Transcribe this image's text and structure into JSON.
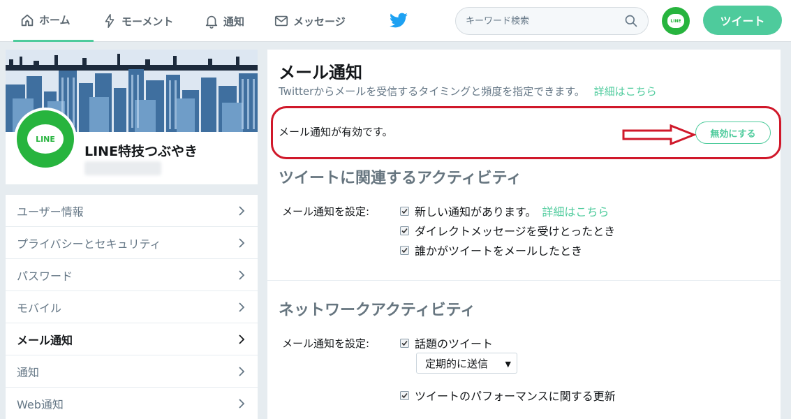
{
  "nav": {
    "home": "ホーム",
    "moments": "モーメント",
    "notifications": "通知",
    "messages": "メッセージ"
  },
  "search": {
    "placeholder": "キーワード検索"
  },
  "tweet_button": "ツイート",
  "avatar_text": "LINE",
  "profile": {
    "name": "LINE特技つぶやき"
  },
  "sidebar": {
    "items": [
      {
        "label": "ユーザー情報"
      },
      {
        "label": "プライバシーとセキュリティ"
      },
      {
        "label": "パスワード"
      },
      {
        "label": "モバイル"
      },
      {
        "label": "メール通知",
        "active": true
      },
      {
        "label": "通知"
      },
      {
        "label": "Web通知"
      }
    ]
  },
  "main": {
    "title": "メール通知",
    "description": "Twitterからメールを受信するタイミングと頻度を指定できます。",
    "details_link": "詳細はこちら",
    "status_text": "メール通知が有効です。",
    "disable_button": "無効にする",
    "tweet_activity": {
      "title": "ツイートに関連するアクティビティ",
      "set_label": "メール通知を設定:",
      "options": [
        {
          "label": "新しい通知があります。",
          "link": "詳細はこちら",
          "checked": true
        },
        {
          "label": "ダイレクトメッセージを受けとったとき",
          "checked": true
        },
        {
          "label": "誰かがツイートをメールしたとき",
          "checked": true
        }
      ]
    },
    "network_activity": {
      "title": "ネットワークアクティビティ",
      "set_label": "メール通知を設定:",
      "options": [
        {
          "label": "話題のツイート",
          "checked": true
        },
        {
          "label": "ツイートのパフォーマンスに関する更新",
          "checked": true
        }
      ],
      "frequency_selected": "定期的に送信"
    }
  },
  "colors": {
    "accent": "#4ecb9c",
    "line_green": "#27b43e",
    "annotation_red": "#d0182a"
  }
}
